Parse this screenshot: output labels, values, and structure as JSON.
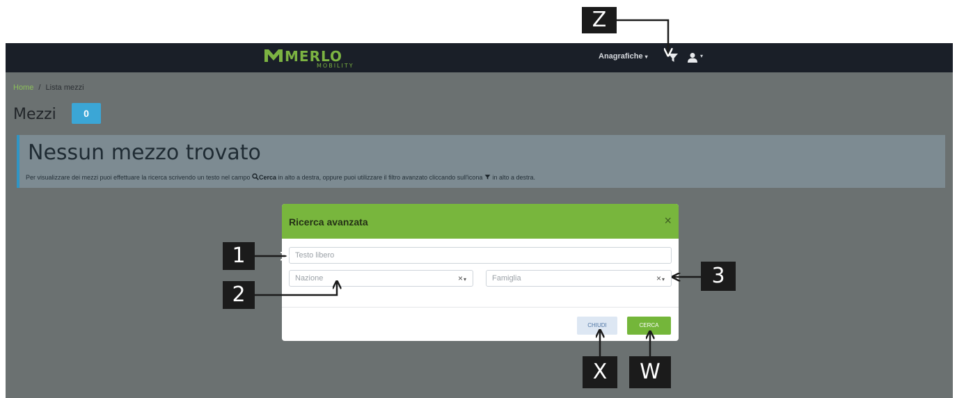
{
  "navbar": {
    "brand": "MERLO",
    "brand_sub": "MOBILITY",
    "menu_label": "Anagrafiche",
    "caret": "▾"
  },
  "breadcrumb": {
    "home": "Home",
    "separator": "/",
    "current": "Lista mezzi"
  },
  "page": {
    "title": "Mezzi",
    "count": "0"
  },
  "alert": {
    "title": "Nessun mezzo trovato",
    "text_1": "Per visualizzare dei mezzi puoi effettuare la ricerca scrivendo un testo nel campo",
    "search_word": "Cerca",
    "text_2": "in alto a destra, oppure puoi utilizzare il filtro avanzato cliccando sull'icona",
    "text_3": "in alto a destra."
  },
  "modal": {
    "title": "Ricerca avanzata",
    "close_symbol": "×",
    "free_text_placeholder": "Testo libero",
    "nation_placeholder": "Nazione",
    "family_placeholder": "Famiglia",
    "clear_symbol": "×",
    "close_button": "CHIUDI",
    "search_button": "CERCA"
  },
  "callouts": {
    "z": "Z",
    "one": "1",
    "two": "2",
    "three": "3",
    "x": "X",
    "w": "W"
  },
  "colors": {
    "navbar": "#1a1f28",
    "brand_green": "#7cb342",
    "header_green": "#78b63d",
    "badge_blue": "#3ba6d6",
    "overlay": "#6b7171"
  },
  "icons": [
    "merlo-logo-icon",
    "filter-icon",
    "user-icon",
    "search-icon",
    "close-icon",
    "clear-icon",
    "chevron-down-icon"
  ]
}
